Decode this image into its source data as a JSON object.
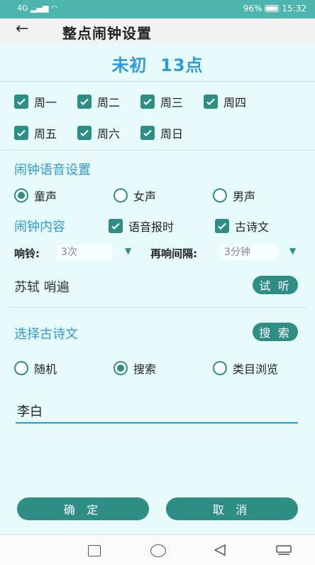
{
  "statusbar": {
    "signal": "4G",
    "battery": "96%",
    "time": "15:32"
  },
  "header": {
    "title": "整点闹钟设置"
  },
  "big_title": "未初  13点",
  "days": [
    {
      "label": "周一",
      "checked": true
    },
    {
      "label": "周二",
      "checked": true
    },
    {
      "label": "周三",
      "checked": true
    },
    {
      "label": "周四",
      "checked": true
    },
    {
      "label": "周五",
      "checked": true
    },
    {
      "label": "周六",
      "checked": true
    },
    {
      "label": "周日",
      "checked": true
    }
  ],
  "voice": {
    "title": "闹钟语音设置",
    "options": [
      {
        "label": "童声",
        "selected": true
      },
      {
        "label": "女声",
        "selected": false
      },
      {
        "label": "男声",
        "selected": false
      }
    ]
  },
  "content": {
    "title": "闹钟内容",
    "options": [
      {
        "label": "语音报时",
        "checked": true
      },
      {
        "label": "古诗文",
        "checked": true
      }
    ]
  },
  "ring": {
    "label": "响铃:",
    "value": "3次",
    "interval_label": "再响间隔:",
    "interval_value": "3分钟"
  },
  "poem": {
    "current": "苏轼 哨遍",
    "preview_label": "试 听"
  },
  "choose": {
    "title": "选择古诗文",
    "search_label": "搜 索",
    "options": [
      {
        "label": "随机",
        "selected": false
      },
      {
        "label": "搜索",
        "selected": true
      },
      {
        "label": "类目浏览",
        "selected": false
      }
    ],
    "search_value": "李白"
  },
  "buttons": {
    "confirm": "确 定",
    "cancel": "取 消"
  },
  "colors": {
    "accent": "#2e8e86",
    "title_blue": "#2e9bd6",
    "status_bar": "#4db5ad",
    "background": "#e8fbfb"
  }
}
